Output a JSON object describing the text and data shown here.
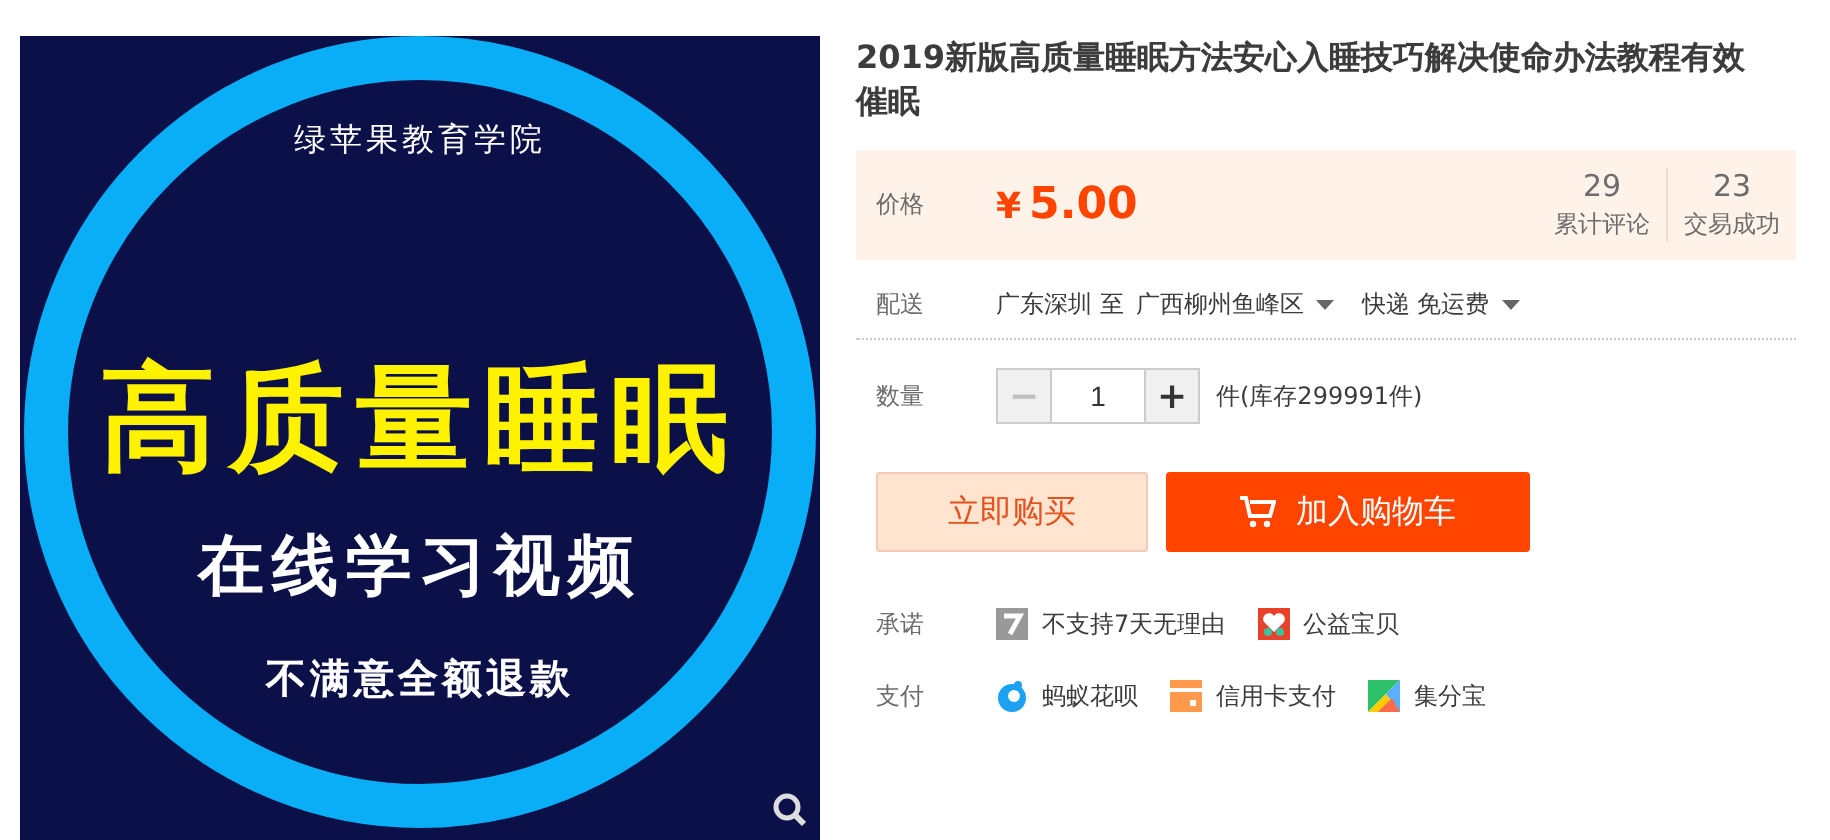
{
  "gallery": {
    "main_image": {
      "brand": "绿苹果教育学院",
      "headline": "高质量睡眠",
      "subline": "在线学习视频",
      "note": "不满意全额退款"
    }
  },
  "product": {
    "title": "2019新版高质量睡眠方法安心入睡技巧解决使命办法教程有效催眠",
    "price": {
      "label": "价格",
      "currency": "¥",
      "amount": "5.00"
    },
    "stats": [
      {
        "value": "29",
        "label": "累计评论"
      },
      {
        "value": "23",
        "label": "交易成功"
      }
    ],
    "delivery": {
      "label": "配送",
      "from": "广东深圳 至",
      "to": "广西柳州鱼峰区",
      "shipping": "快递 免运费"
    },
    "quantity": {
      "label": "数量",
      "value": "1",
      "minus": "−",
      "plus": "+",
      "stock": "件(库存299991件)",
      "minus_disabled": true
    },
    "buttons": [
      {
        "kind": "buy",
        "label": "立即购买"
      },
      {
        "kind": "cart",
        "label": "加入购物车"
      }
    ],
    "promises": {
      "label": "承诺",
      "items": [
        {
          "kind": "seven",
          "text": "不支持7天无理由"
        },
        {
          "kind": "charity",
          "text": "公益宝贝"
        }
      ]
    },
    "payment": {
      "label": "支付",
      "items": [
        {
          "kind": "huabei",
          "text": "蚂蚁花呗"
        },
        {
          "kind": "card",
          "text": "信用卡支付"
        },
        {
          "kind": "jifen",
          "text": "集分宝"
        }
      ]
    }
  }
}
